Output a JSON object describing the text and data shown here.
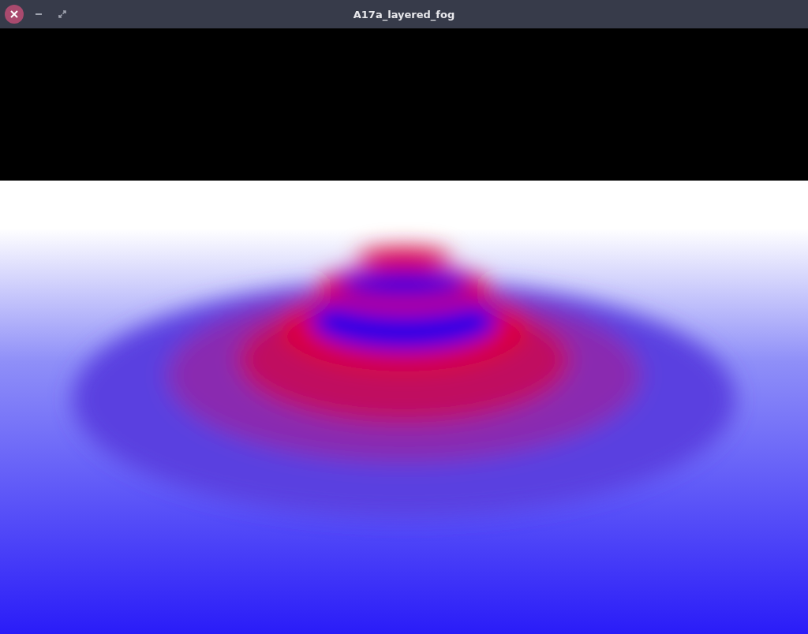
{
  "window": {
    "title": "A17a_layered_fog"
  }
}
